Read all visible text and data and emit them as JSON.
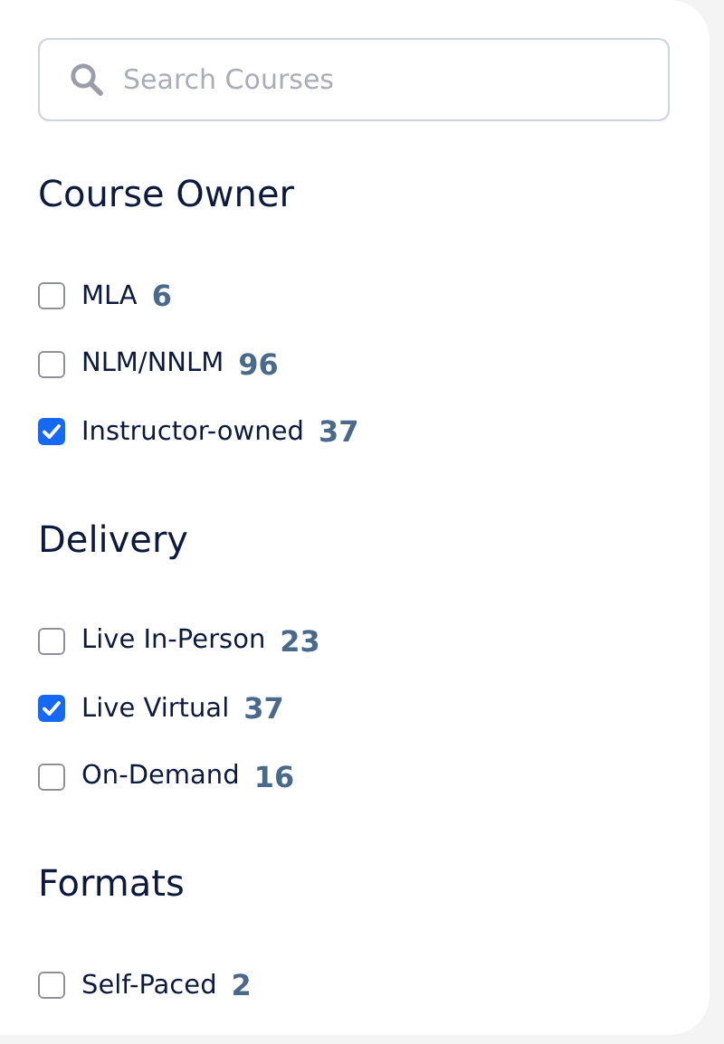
{
  "search": {
    "placeholder": "Search Courses"
  },
  "sections": [
    {
      "title": "Course Owner",
      "options": [
        {
          "label": "MLA",
          "count": "6",
          "checked": false
        },
        {
          "label": "NLM/NNLM",
          "count": "96",
          "checked": false
        },
        {
          "label": "Instructor-owned",
          "count": "37",
          "checked": true
        }
      ]
    },
    {
      "title": "Delivery",
      "options": [
        {
          "label": "Live In-Person",
          "count": "23",
          "checked": false
        },
        {
          "label": "Live Virtual",
          "count": "37",
          "checked": true
        },
        {
          "label": "On-Demand",
          "count": "16",
          "checked": false
        }
      ]
    },
    {
      "title": "Formats",
      "options": [
        {
          "label": "Self-Paced",
          "count": "2",
          "checked": false
        }
      ]
    }
  ]
}
